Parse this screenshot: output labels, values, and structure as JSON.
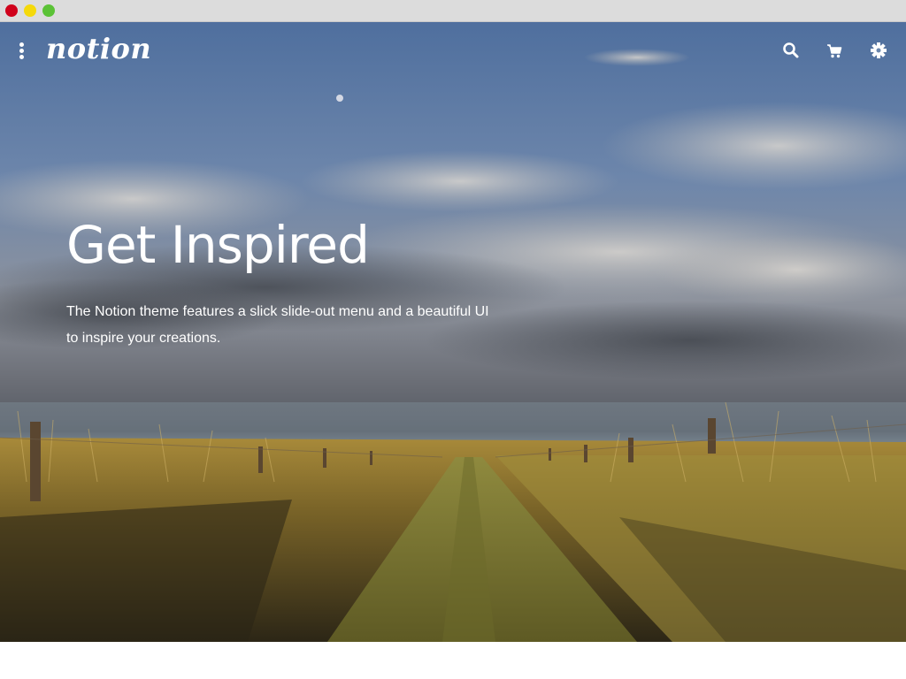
{
  "window": {
    "controls": [
      "close",
      "minimize",
      "maximize"
    ],
    "colors": {
      "close": "#d0021b",
      "minimize": "#f5d90a",
      "maximize": "#5bc236"
    }
  },
  "nav": {
    "menu_icon": "vertical-dots-icon",
    "logo_text": "notion",
    "icons": [
      "search-icon",
      "cart-icon",
      "gear-icon"
    ]
  },
  "hero": {
    "title": "Get Inspired",
    "description_line1": "The Notion theme features a slick slide-out menu and a beautiful UI",
    "description_line2": "to inspire your creations."
  },
  "colors": {
    "text": "#ffffff",
    "sky": "#5a78a4",
    "field": "#b8953f"
  }
}
